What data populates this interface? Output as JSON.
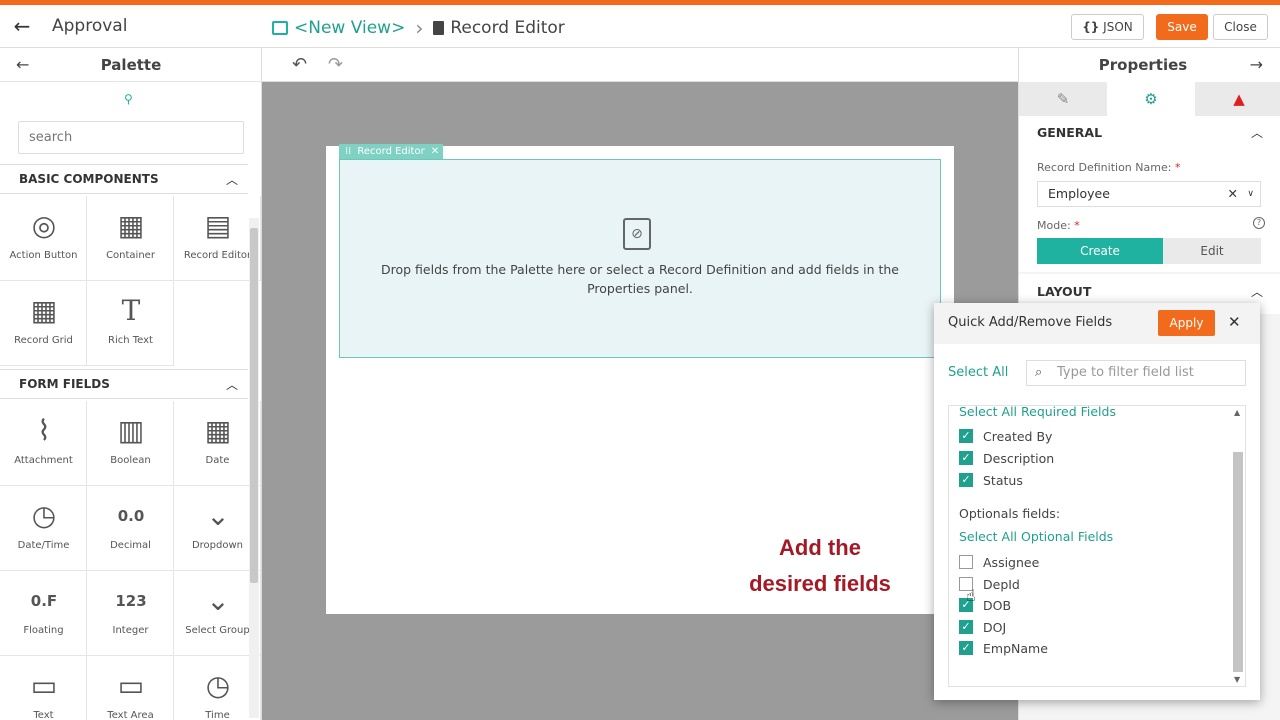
{
  "header": {
    "back_icon": "arrow-left-icon",
    "app_title": "Approval",
    "crumb_link": "<New View>",
    "crumb_current": "Record Editor",
    "json_label": "JSON",
    "json_prefix": "{}",
    "save_label": "Save",
    "close_label": "Close"
  },
  "palette": {
    "title": "Palette",
    "search_placeholder": "search",
    "sections": [
      {
        "label": "BASIC COMPONENTS",
        "items": [
          {
            "label": "Action Button",
            "icon": "target-icon",
            "glyph": "◎"
          },
          {
            "label": "Container",
            "icon": "container-icon",
            "glyph": "▦"
          },
          {
            "label": "Record Editor",
            "icon": "document-icon",
            "glyph": "▤"
          },
          {
            "label": "Record Grid",
            "icon": "grid-icon",
            "glyph": "▦"
          },
          {
            "label": "Rich Text",
            "icon": "text-t-icon",
            "glyph": "T"
          }
        ]
      },
      {
        "label": "FORM FIELDS",
        "items": [
          {
            "label": "Attachment",
            "icon": "paperclip-icon",
            "glyph": "⌇"
          },
          {
            "label": "Boolean",
            "icon": "boolean-icon",
            "glyph": "▥"
          },
          {
            "label": "Date",
            "icon": "calendar-icon",
            "glyph": "▦"
          },
          {
            "label": "Date/Time",
            "icon": "calendar-clock-icon",
            "glyph": "◷"
          },
          {
            "label": "Decimal",
            "icon": "decimal-icon",
            "glyph": "0.0"
          },
          {
            "label": "Dropdown",
            "icon": "dropdown-icon",
            "glyph": "⌄"
          },
          {
            "label": "Floating",
            "icon": "floating-icon",
            "glyph": "0.F"
          },
          {
            "label": "Integer",
            "icon": "integer-icon",
            "glyph": "123"
          },
          {
            "label": "Select Group",
            "icon": "select-group-icon",
            "glyph": "⌄"
          },
          {
            "label": "Text",
            "icon": "text-field-icon",
            "glyph": "▭"
          },
          {
            "label": "Text Area",
            "icon": "text-area-icon",
            "glyph": "▭"
          },
          {
            "label": "Time",
            "icon": "clock-icon",
            "glyph": "◷"
          }
        ]
      }
    ]
  },
  "canvas": {
    "component_tag": "Record Editor",
    "drop_message": "Drop fields from the Palette here or select a Record Definition and add fields in the Properties panel.",
    "callout_line1": "Add the",
    "callout_line2": "desired fields"
  },
  "properties": {
    "title": "Properties",
    "general_label": "GENERAL",
    "record_def_label": "Record Definition Name:",
    "record_def_value": "Employee",
    "mode_label": "Mode:",
    "mode_create": "Create",
    "mode_edit": "Edit",
    "layout_label": "LAYOUT",
    "required_mark": "*"
  },
  "quick_add": {
    "title": "Quick Add/Remove Fields",
    "apply_label": "Apply",
    "select_all_label": "Select All",
    "filter_placeholder": "Type to filter field list",
    "select_all_required": "Select All Required Fields",
    "required_fields": [
      {
        "label": "Created By",
        "checked": true
      },
      {
        "label": "Description",
        "checked": true
      },
      {
        "label": "Status",
        "checked": true
      }
    ],
    "optional_heading": "Optionals fields:",
    "select_all_optional": "Select All Optional Fields",
    "optional_fields": [
      {
        "label": "Assignee",
        "checked": false
      },
      {
        "label": "DepId",
        "checked": false
      },
      {
        "label": "DOB",
        "checked": true
      },
      {
        "label": "DOJ",
        "checked": true
      },
      {
        "label": "EmpName",
        "checked": true
      }
    ]
  },
  "colors": {
    "accent_orange": "#f26b1c",
    "teal": "#20a08f",
    "callout_red": "#a31a26"
  }
}
